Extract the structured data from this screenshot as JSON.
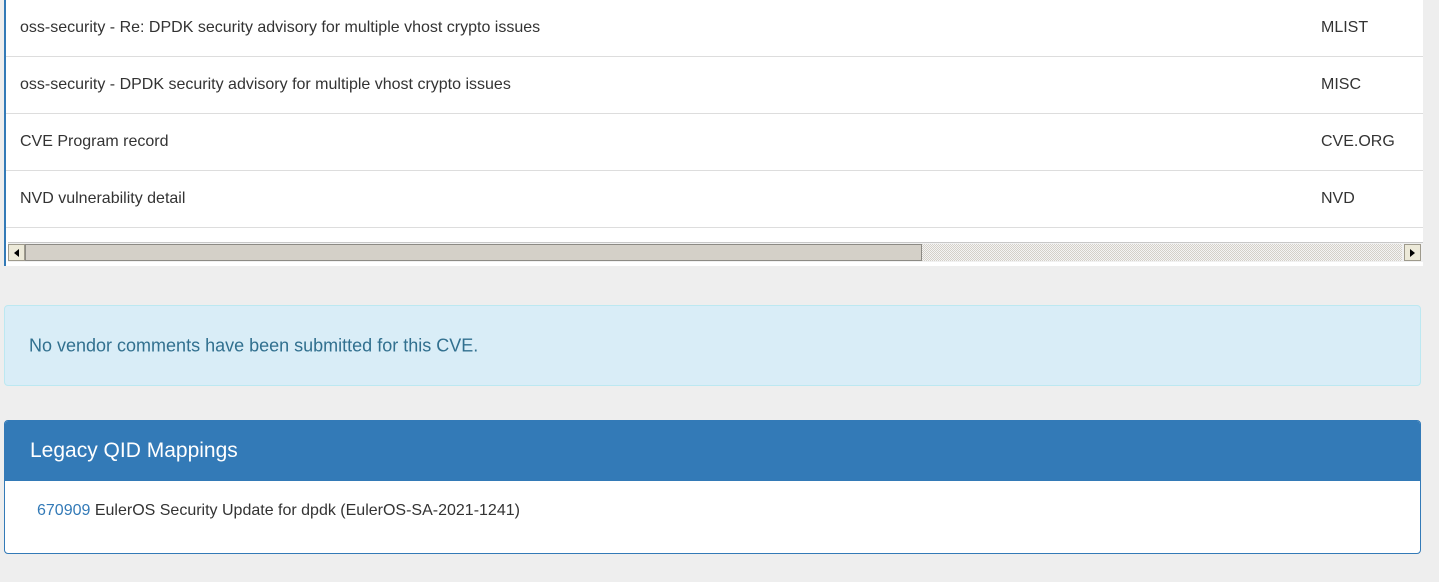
{
  "references": {
    "rows": [
      {
        "name": "oss-security - Re: DPDK security advisory for multiple vhost crypto issues",
        "source": "MLIST"
      },
      {
        "name": "oss-security - DPDK security advisory for multiple vhost crypto issues",
        "source": "MISC"
      },
      {
        "name": "CVE Program record",
        "source": "CVE.ORG"
      },
      {
        "name": "NVD vulnerability detail",
        "source": "NVD"
      }
    ],
    "scroll_position": 0.65
  },
  "vendor_comments": {
    "message": "No vendor comments have been submitted for this CVE."
  },
  "legacy_qid": {
    "heading": "Legacy QID Mappings",
    "items": [
      {
        "qid": "670909",
        "title": "EulerOS Security Update for dpdk (EulerOS-SA-2021-1241)"
      }
    ]
  },
  "colors": {
    "primary": "#337ab7",
    "info_bg": "#d9edf7",
    "info_text": "#31708f",
    "page_bg": "#eeeeee"
  }
}
